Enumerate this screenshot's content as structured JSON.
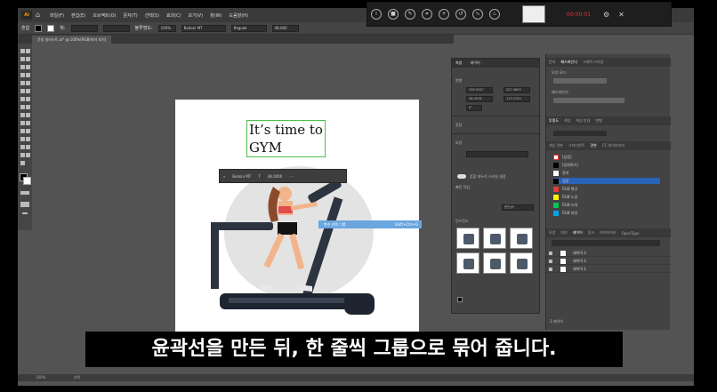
{
  "app": {
    "logo": "Ai",
    "menu": [
      "파일(F)",
      "편집(E)",
      "오브젝트(O)",
      "문자(T)",
      "선택(S)",
      "효과(C)",
      "보기(V)",
      "창(W)",
      "도움말(H)"
    ]
  },
  "recorder": {
    "timer": "00:00:01",
    "icons": [
      "info-icon",
      "stop-icon",
      "edit-icon",
      "crop-icon",
      "zoom-icon",
      "speed-icon",
      "draw-icon",
      "fire-icon",
      "settings-icon",
      "close-icon"
    ]
  },
  "control_bar": {
    "selection_label": "혼합",
    "stroke_label": "획:",
    "opacity_label": "불투명도:",
    "opacity_value": "100%",
    "font_value": "Bodoni MT",
    "font_style": "Regular",
    "font_size": "48.000"
  },
  "document_tab": {
    "label": "운동 일러스트.ai* @ 100%(RGB/미리 보기)"
  },
  "artboard": {
    "headline_line1": "It’s time to",
    "headline_line2": "GYM"
  },
  "float_bar": {
    "font": "Bodoni MT",
    "size": "48.0000"
  },
  "hover_chip": {
    "label": "복수 선택 그룹",
    "shortcut": "Shift+Ctrl+G"
  },
  "properties": {
    "tabs": [
      "속성",
      "레이어"
    ],
    "section_transform": "변형",
    "x": "209.5347",
    "y": "58.0578",
    "w": "227.4803",
    "h": "113.3720",
    "angle": "0°",
    "section_group": "혼합",
    "section_appearance": "모양",
    "section_quick": "빠른 작업",
    "toggle_label": "혼합 테두리 스타일 설정",
    "gen_button": "문단(P)",
    "section_swatches": "인스턴스"
  },
  "dock": {
    "top_tabs": [
      "문자",
      "패스파인더",
      "그래픽 스타일"
    ],
    "shape_mode_label": "모양 모드:",
    "pathfinder_label": "패스파인더:",
    "mid_tabs": [
      "투명도",
      "색상",
      "색상 안내",
      "변형"
    ],
    "swatch_tabs": [
      "색상 견본",
      "그라디언트",
      "견본",
      "CC 라이브러리"
    ],
    "swatches": [
      {
        "name": "[없음]",
        "color": "#ffffff"
      },
      {
        "name": "[맞춰찍기]",
        "color": "#000000"
      },
      {
        "name": "흰색",
        "color": "#ffffff"
      },
      {
        "name": "검정",
        "color": "#000000"
      },
      {
        "name": "RGB 빨강",
        "color": "#e53935"
      },
      {
        "name": "RGB 노랑",
        "color": "#fff200"
      },
      {
        "name": "RGB 녹색",
        "color": "#00c853"
      },
      {
        "name": "RGB 파랑",
        "color": "#00a2e8"
      }
    ],
    "layer_tabs": [
      "모양",
      "대지",
      "레이어",
      "링크",
      "라이브러리",
      "OpenType"
    ],
    "layers": [
      "레이어 3",
      "레이어 2",
      "레이어 1"
    ],
    "layers_count": "3 레이어"
  },
  "status": {
    "zoom": "100%",
    "mode": "선택"
  },
  "subtitle": "윤곽선을 만든 뒤, 한 줄씩 그룹으로 묶어 줍니다."
}
